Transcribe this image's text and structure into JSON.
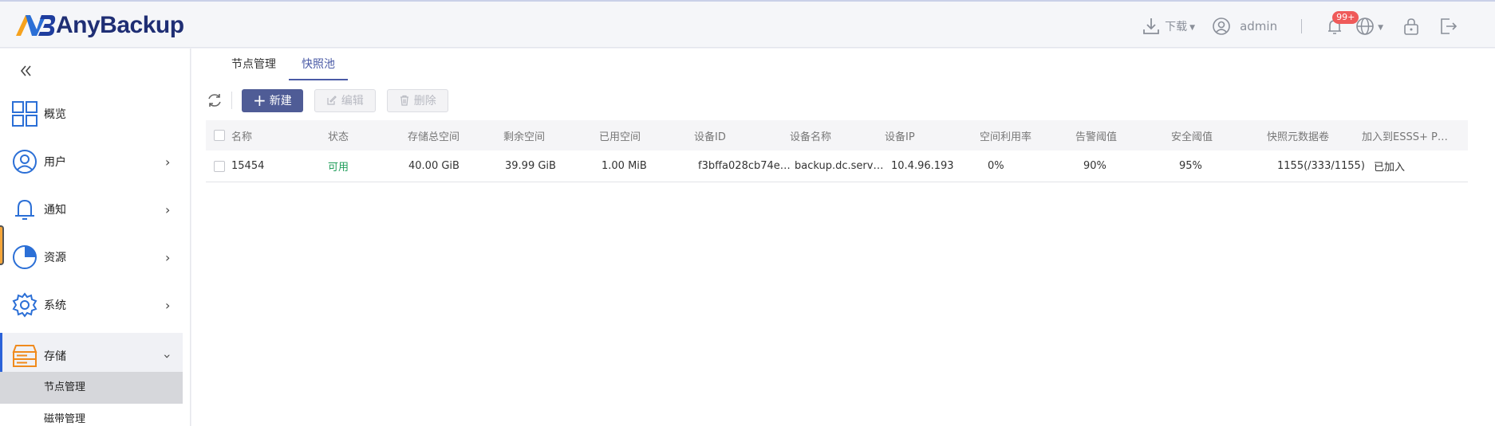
{
  "app": {
    "name": "AnyBackup",
    "brand_color": "#1f2e74",
    "accent_color": "#4f5c96"
  },
  "header": {
    "download_label": "下载",
    "user_label": "admin",
    "notification_badge": "99+",
    "icons": [
      "download-icon",
      "user-circle-icon",
      "bell-icon",
      "globe-icon",
      "lock-icon",
      "logout-icon"
    ]
  },
  "sidebar": {
    "items": [
      {
        "label": "概览",
        "icon": "overview-grid-icon"
      },
      {
        "label": "用户",
        "icon": "user-icon"
      },
      {
        "label": "通知",
        "icon": "bell-icon"
      },
      {
        "label": "资源",
        "icon": "pie-chart-icon"
      },
      {
        "label": "系统",
        "icon": "gear-icon"
      },
      {
        "label": "存储",
        "icon": "storage-icon"
      }
    ],
    "sub_items": [
      {
        "label": "节点管理"
      },
      {
        "label": "磁带管理"
      }
    ]
  },
  "tabs": [
    {
      "label": "节点管理"
    },
    {
      "label": "快照池"
    }
  ],
  "toolbar": {
    "new_label": "新建",
    "edit_label": "编辑",
    "delete_label": "删除"
  },
  "table": {
    "columns": [
      "名称",
      "状态",
      "存储总空间",
      "剩余空间",
      "已用空间",
      "设备ID",
      "设备名称",
      "设备IP",
      "空间利用率",
      "告警阈值",
      "安全阈值",
      "快照元数据卷",
      "加入到ESSS+ P…"
    ],
    "rows": [
      {
        "name": "15454",
        "status": "可用",
        "total": "40.00 GiB",
        "free": "39.99 GiB",
        "used": "1.00 MiB",
        "device_id": "f3bffa028cb74e…",
        "device_name": "backup.dc.serv…",
        "device_ip": "10.4.96.193",
        "utilization": "0%",
        "alert_threshold": "90%",
        "safe_threshold": "95%",
        "metadata_volume": "1155(/333/1155)",
        "joined": "已加入"
      }
    ]
  }
}
